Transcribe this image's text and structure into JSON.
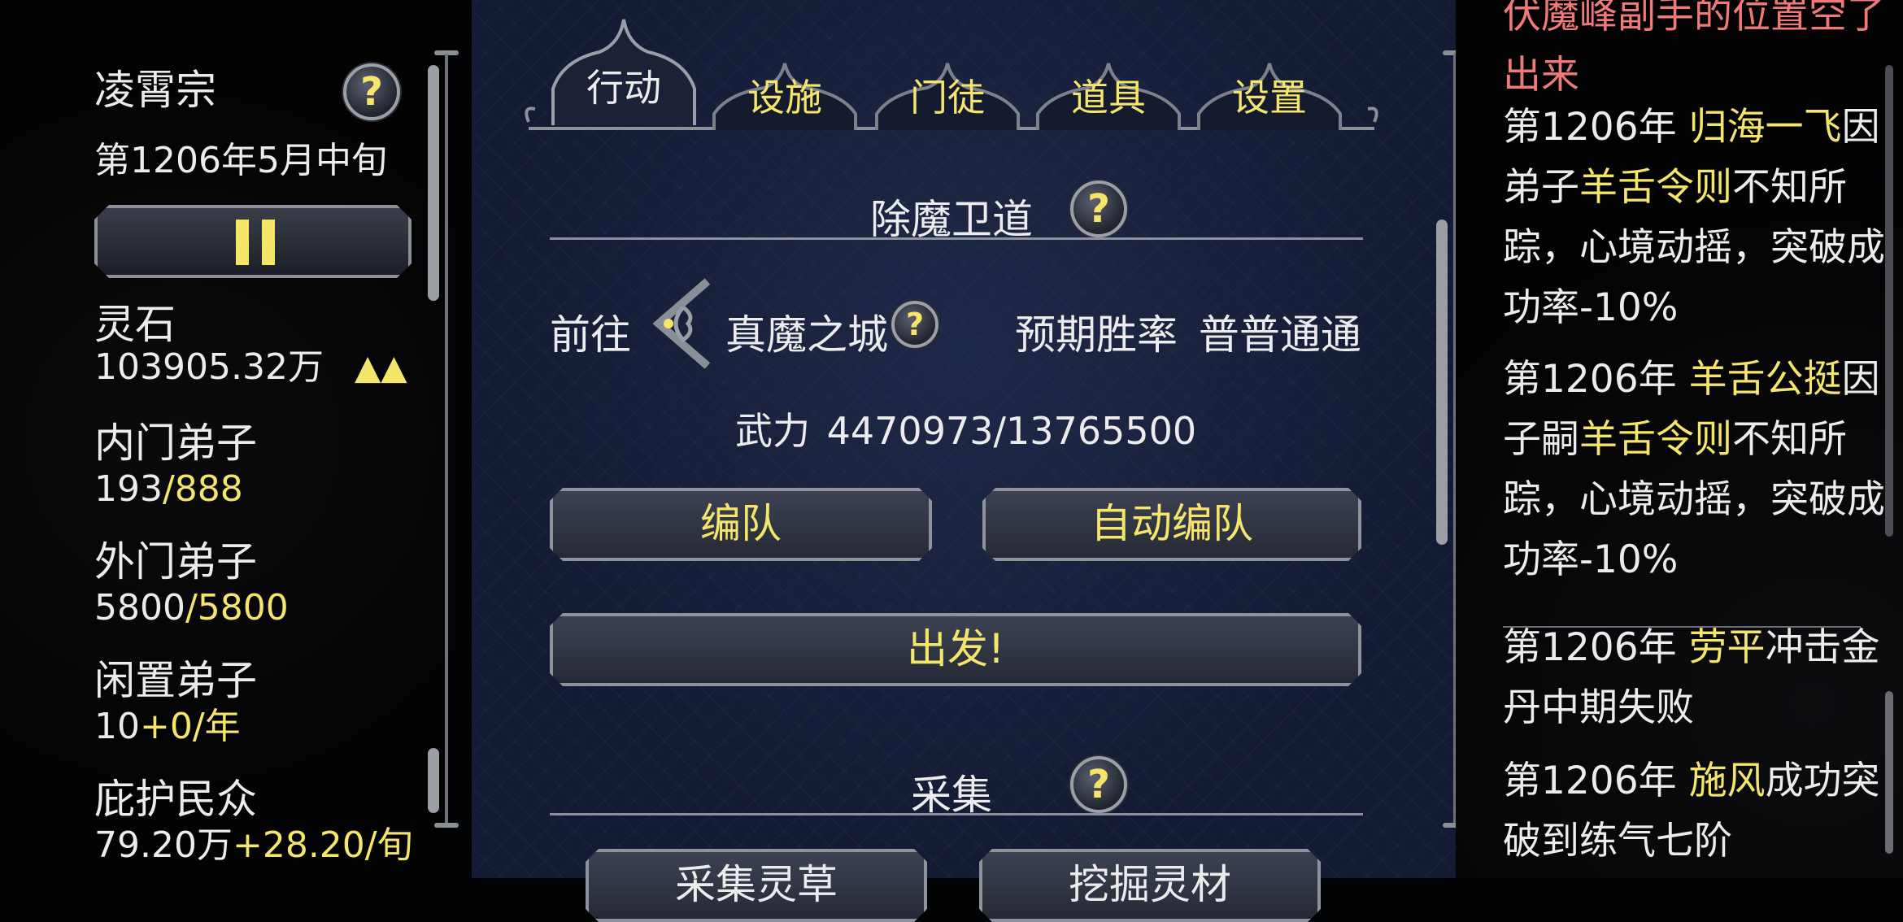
{
  "left": {
    "sect_name": "凌霄宗",
    "date": "第1206年5月中旬",
    "spirit_stone_label": "灵石",
    "spirit_stone_value": "103905.32万",
    "spirit_stone_trend": "▲▲",
    "inner_label": "内门弟子",
    "inner_current": "193",
    "inner_max": "/888",
    "outer_label": "外门弟子",
    "outer_current": "5800",
    "outer_max": "/5800",
    "idle_label": "闲置弟子",
    "idle_current": "10",
    "idle_rate": "+0/年",
    "people_label": "庇护民众",
    "people_current": "79.20万",
    "people_rate": "+28.20/旬",
    "help_mark": "?"
  },
  "tabs": [
    "行动",
    "设施",
    "门徒",
    "道具",
    "设置"
  ],
  "active_tab": "行动",
  "mission": {
    "title": "除魔卫道",
    "goto_label": "前往",
    "destination": "真魔之城",
    "win_rate_label": "预期胜率",
    "win_rate_value": "普普通通",
    "power_label": "武力",
    "power_value": "4470973/13765500",
    "formation_button": "编队",
    "auto_formation_button": "自动编队",
    "depart_button": "出发!"
  },
  "gather": {
    "title": "采集",
    "herb_button": "采集灵草",
    "dig_button": "挖掘灵材"
  },
  "log": [
    {
      "parts": [
        {
          "text": "伏魔峰副手的位置空了出来",
          "style": "red"
        }
      ]
    },
    {
      "parts": [
        {
          "text": "第1206年 ",
          "style": "white"
        },
        {
          "text": "归海一飞",
          "style": "yellow"
        },
        {
          "text": "因弟子",
          "style": "white"
        },
        {
          "text": "羊舌令则",
          "style": "yellow"
        },
        {
          "text": "不知所踪，心境动摇，突破成功率-10%",
          "style": "white"
        }
      ]
    },
    {
      "parts": [
        {
          "text": "第1206年 ",
          "style": "white"
        },
        {
          "text": "羊舌公挺",
          "style": "yellow"
        },
        {
          "text": "因子嗣",
          "style": "white"
        },
        {
          "text": "羊舌令则",
          "style": "yellow"
        },
        {
          "text": "不知所踪，心境动摇，突破成功率-10%",
          "style": "white"
        }
      ]
    },
    {
      "parts": [
        {
          "text": "第1206年 ",
          "style": "white"
        },
        {
          "text": "劳平",
          "style": "yellow"
        },
        {
          "text": "冲击金丹中期失败",
          "style": "white"
        }
      ]
    },
    {
      "parts": [
        {
          "text": "第1206年 ",
          "style": "white"
        },
        {
          "text": "施风",
          "style": "yellow"
        },
        {
          "text": "成功突破到练气七阶",
          "style": "white"
        }
      ]
    }
  ],
  "colors": {
    "accent": "#f6e56b",
    "alert": "#f07a78",
    "panel": "#131a33"
  }
}
